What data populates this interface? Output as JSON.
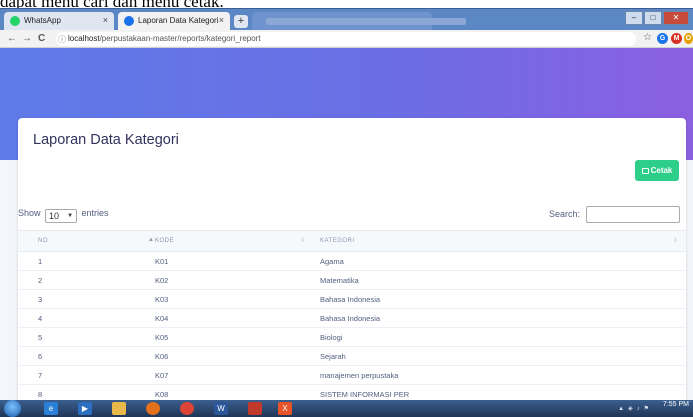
{
  "caption": {
    "text": "dapat menu cari dan menu cetak."
  },
  "browser": {
    "tabs": [
      {
        "label": "WhatsApp",
        "close": "×",
        "favicon_color": "#25d366"
      },
      {
        "label": "Laporan Data Kategori",
        "close": "×",
        "favicon_color": "#1a73e8"
      }
    ],
    "new_tab": "+",
    "window_buttons": {
      "minimize": "–",
      "maximize": "□",
      "close": "✕"
    },
    "nav": {
      "back": "←",
      "forward": "→",
      "reload": "C"
    },
    "url": {
      "host": "localhost",
      "path": "/perpustakaan-master/reports/kategori_report"
    },
    "extensions": {
      "star": "☆",
      "ext1": "G",
      "ext2": "M",
      "ext3": "O"
    }
  },
  "page": {
    "title": "Laporan Data Kategori",
    "print_button": "Cetak",
    "show_label": "Show",
    "entries_label": "entries",
    "page_length": "10",
    "search_label": "Search:",
    "search_value": "",
    "columns": [
      "NO",
      "KODE",
      "KATEGORI"
    ],
    "rows": [
      {
        "no": "1",
        "kode": "K01",
        "kategori": "Agama"
      },
      {
        "no": "2",
        "kode": "K02",
        "kategori": "Matematika"
      },
      {
        "no": "3",
        "kode": "K03",
        "kategori": "Bahasa Indonesia"
      },
      {
        "no": "4",
        "kode": "K04",
        "kategori": "Bahasa Indonesia"
      },
      {
        "no": "5",
        "kode": "K05",
        "kategori": "Biologi"
      },
      {
        "no": "6",
        "kode": "K06",
        "kategori": "Sejarah"
      },
      {
        "no": "7",
        "kode": "K07",
        "kategori": "manajemen perpustaka"
      },
      {
        "no": "8",
        "kode": "K08",
        "kategori": "SISTEM INFORMASI PER"
      }
    ],
    "colors": {
      "accent_green": "#2dce89",
      "hero_start": "#5f7ae8",
      "hero_end": "#8b5fe0"
    }
  },
  "taskbar": {
    "time": "7:55 PM",
    "icons": [
      "start-orb",
      "ie-icon",
      "media-icon",
      "folder-icon",
      "firefox-icon",
      "chrome-icon",
      "word-icon",
      "app-icon",
      "xampp-icon"
    ]
  }
}
